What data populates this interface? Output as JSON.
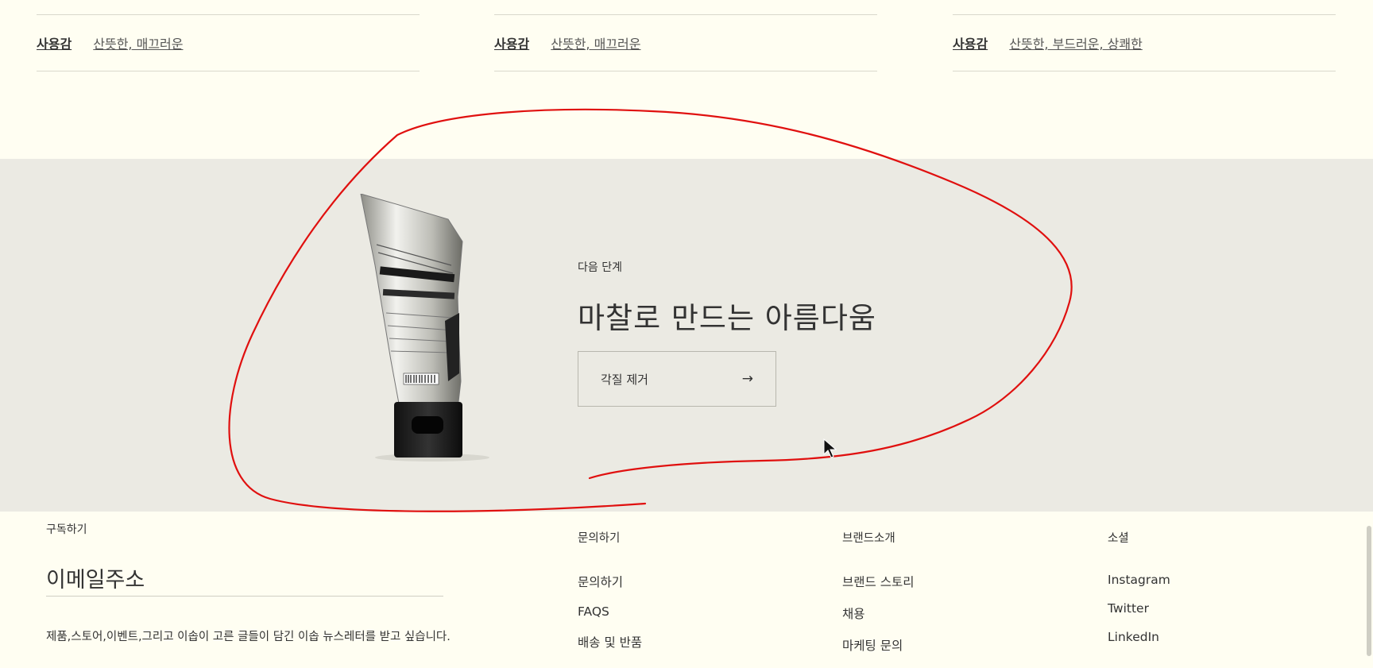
{
  "features": [
    {
      "key": "사용감",
      "value": "산뜻한, 매끄러운"
    },
    {
      "key": "사용감",
      "value": "산뜻한, 매끄러운"
    },
    {
      "key": "사용감",
      "value": "산뜻한, 부드러운, 상쾌한"
    }
  ],
  "promo": {
    "eyebrow": "다음 단계",
    "title": "마찰로 만드는 아름다움",
    "cta_label": "각질 제거",
    "cta_icon": "arrow-right-icon",
    "annotation_color": "#e0100f"
  },
  "footer": {
    "subscribe_title": "구독하기",
    "email_placeholder": "이메일주소",
    "consent_text": "제품,스토어,이벤트,그리고 이솝이 고른 글들이 담긴 이솝 뉴스레터를 받고 싶습니다.",
    "columns": [
      {
        "title": "문의하기",
        "links": [
          "문의하기",
          "FAQS",
          "배송 및 반품"
        ]
      },
      {
        "title": "브랜드소개",
        "links": [
          "브랜드 스토리",
          "채용",
          "마케팅 문의"
        ]
      },
      {
        "title": "소셜",
        "links": [
          "Instagram",
          "Twitter",
          "LinkedIn"
        ]
      }
    ]
  },
  "colors": {
    "background": "#fffef2",
    "promo_bg": "#ebeae3",
    "annotation": "#e0100f"
  }
}
